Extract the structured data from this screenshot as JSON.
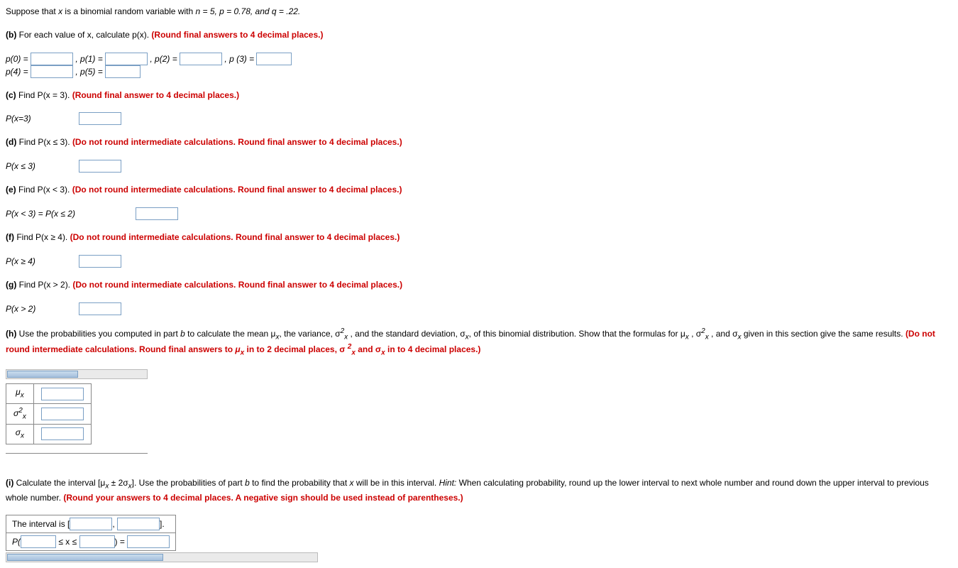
{
  "intro": {
    "prefix": "Suppose that ",
    "xvar": "x",
    "middle": " is a binomial random variable with ",
    "params": "n = 5, p = 0.78, and q = .22."
  },
  "b": {
    "label": "(b)",
    "text": " For each value of x, calculate p(x). ",
    "note": "(Round final answers to 4 decimal places.)",
    "p0": "p(0) = ",
    "p1": ", p(1) = ",
    "p2": ", p(2) = ",
    "p3": ", p (3) = ",
    "p4": "p(4) = ",
    "p5": ", p(5) = "
  },
  "c": {
    "label": "(c)",
    "text": " Find P(x = 3). ",
    "note": "(Round final answer to 4 decimal places.)",
    "answer_label": "P(x=3)"
  },
  "d": {
    "label": "(d)",
    "text": " Find P(x ≤ 3). ",
    "note": "(Do not round intermediate calculations. Round final answer to 4 decimal places.)",
    "answer_label": "P(x ≤ 3)"
  },
  "e": {
    "label": "(e)",
    "text": " Find P(x < 3). ",
    "note": "(Do not round intermediate calculations. Round final answer to 4 decimal places.)",
    "answer_label": "P(x < 3) = P(x ≤ 2)"
  },
  "f": {
    "label": "(f)",
    "text": " Find P(x ≥ 4). ",
    "note": "(Do not round intermediate calculations. Round final answer to 4 decimal places.)",
    "answer_label": "P(x ≥ 4)"
  },
  "g": {
    "label": "(g)",
    "text": " Find P(x > 2). ",
    "note": "(Do not round intermediate calculations. Round final answer to 4 decimal places.)",
    "answer_label": "P(x > 2)"
  },
  "h": {
    "label": "(h)",
    "text1": " Use the probabilities you computed in part ",
    "b_ital": "b",
    "text2": " to calculate the mean μ",
    "sub_x1": "x",
    "text3": ", the variance, σ",
    "text4": " , and the standard deviation, σ",
    "sub_x2": "x",
    "text5": ", of this binomial distribution. Show that the formulas for μ",
    "sub_x3": "x",
    "text6": " , σ",
    "text7": " , and σ",
    "sub_x4": "x",
    "text8": " given in this section give the same results. ",
    "note1": "(Do not round intermediate calculations. Round final answers to ",
    "mu_part": "μ",
    "mu_sub": "x",
    "note2": " in to 2 decimal places, σ ",
    "sigma_sup": "2",
    "sigma_sub": "x",
    "note3": " and σ",
    "sigma_sub2": "x",
    "note4": " in to 4 decimal places.)",
    "row1": "μ",
    "row1_sub": "x",
    "row2": "σ",
    "row2_sup": "2",
    "row2_sub": "x",
    "row3": "σ",
    "row3_sub": "x"
  },
  "i": {
    "label": "(i)",
    "text1": " Calculate the interval [μ",
    "sub_x1": "x",
    "text2": " ± 2σ",
    "sub_x2": "x",
    "text3": "]. Use the probabilities of part ",
    "b_ital": "b",
    "text4": " to find the probability that ",
    "x_ital": "x",
    "text5": " will be in this interval. ",
    "hint_ital": "Hint:",
    "text6": " When calculating probability, round up the lower interval to next whole number and round down the upper interval to previous whole number. ",
    "note": "(Round your answers to 4 decimal places. A negative sign should be used instead of parentheses.)",
    "interval_prefix": "The interval is [",
    "comma": ", ",
    "interval_suffix": "].",
    "p_prefix": "P(",
    "le1": " ≤ x ≤ ",
    "p_mid": ") = "
  }
}
